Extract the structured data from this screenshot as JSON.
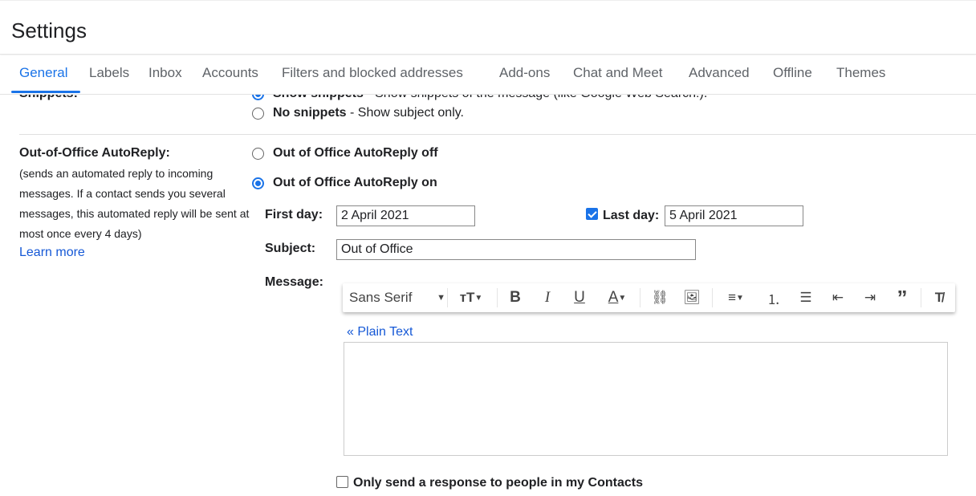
{
  "header": {
    "title": "Settings"
  },
  "tabs": [
    "General",
    "Labels",
    "Inbox",
    "Accounts",
    "Filters and blocked addresses",
    "Add-ons",
    "Chat and Meet",
    "Advanced",
    "Offline",
    "Themes"
  ],
  "active_tab": "General",
  "snippets": {
    "label": "Snippets:",
    "show_bold": "Show snippets",
    "show_rest": " - Show snippets of the message (like Google Web Search!).",
    "none_bold": "No snippets",
    "none_rest": " - Show subject only.",
    "selected": "show"
  },
  "autoreply": {
    "label": "Out-of-Office AutoReply:",
    "description": "(sends an automated reply to incoming messages. If a contact sends you several messages, this automated reply will be sent at most once every 4 days)",
    "learn_more": "Learn more",
    "off_label": "Out of Office AutoReply off",
    "on_label": "Out of Office AutoReply on",
    "selected": "on",
    "first_day_label": "First day:",
    "first_day": "2 April 2021",
    "last_day_label": "Last day:",
    "last_day": "5 April 2021",
    "last_day_checked": true,
    "subject_label": "Subject:",
    "subject": "Out of Office",
    "message_label": "Message:",
    "plain_text": "« Plain Text",
    "contacts_only": "Only send a response to people in my Contacts",
    "contacts_only_checked": false
  },
  "toolbar": {
    "font": "Sans Serif"
  },
  "colors": {
    "accent": "#1a73e8",
    "link": "#1558d6"
  }
}
